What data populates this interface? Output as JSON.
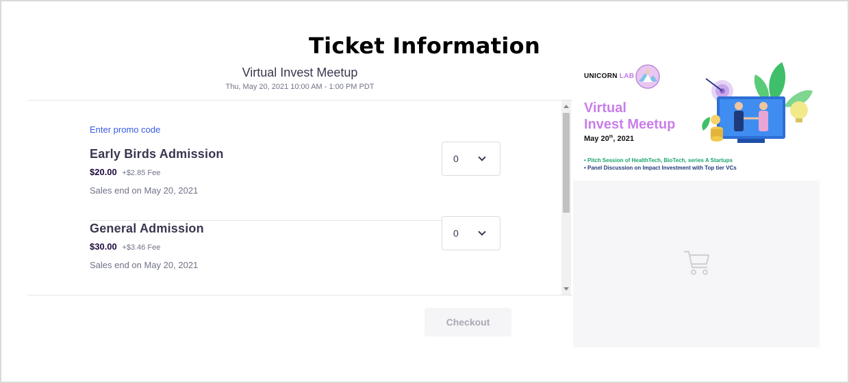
{
  "page_title": "Ticket Information",
  "event": {
    "name": "Virtual Invest Meetup",
    "datetime": "Thu, May 20, 2021 10:00 AM - 1:00 PM PDT"
  },
  "promo_link": "Enter promo code",
  "tickets": [
    {
      "name": "Early Birds Admission",
      "price": "$20.00",
      "fee": "+$2.85 Fee",
      "sales_end": "Sales end on May 20, 2021",
      "quantity": "0"
    },
    {
      "name": "General Admission",
      "price": "$30.00",
      "fee": "+$3.46 Fee",
      "sales_end": "Sales end on May 20, 2021",
      "quantity": "0"
    }
  ],
  "checkout_label": "Checkout",
  "banner": {
    "logo_main": "UNICORN",
    "logo_accent": "LAB",
    "title_line1": "Virtual",
    "title_line2": "Invest Meetup",
    "date_main": "May 20",
    "date_sup": "th",
    "date_year": ", 2021",
    "bullet1": "• Pitch Session of HealthTech, BioTech, series A Startups",
    "bullet2": "• Panel Discussion on Impact Investment with Top tier VCs"
  },
  "colors": {
    "link": "#3659e3",
    "banner_title": "#c97ee9",
    "checkout_disabled_bg": "#f5f5f7",
    "checkout_disabled_text": "#a9a8b3"
  },
  "icons": [
    "chevron-down-icon",
    "cart-icon",
    "unicorn-lab-logo",
    "meetup-illustration"
  ]
}
